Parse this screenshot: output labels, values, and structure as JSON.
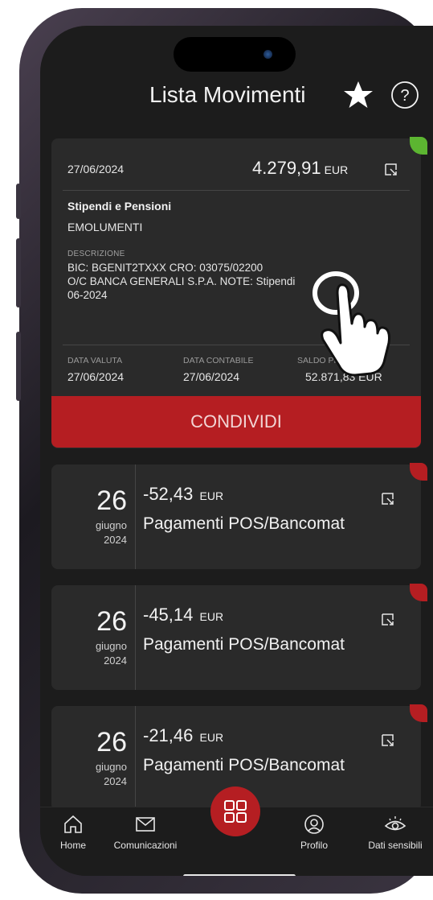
{
  "header": {
    "title": "Lista Movimenti"
  },
  "detail": {
    "date": "27/06/2024",
    "amount": "4.279,91",
    "currency": "EUR",
    "category": "Stipendi e Pensioni",
    "subcategory": "EMOLUMENTI",
    "description_label": "DESCRIZIONE",
    "description_line1": "BIC: BGENIT2TXXX CRO: 03075/02200",
    "description_line2": "O/C BANCA GENERALI S.P.A. NOTE: Stipendi",
    "description_line3": "06-2024",
    "valuta_label": "DATA VALUTA",
    "valuta_value": "27/06/2024",
    "contabile_label": "DATA CONTABILE",
    "contabile_value": "27/06/2024",
    "saldo_label": "SALDO PROGR",
    "saldo_value": "52.871,83 EUR",
    "status_color": "#5cb531"
  },
  "share_button": "CONDIVIDI",
  "movements": [
    {
      "day": "26",
      "month": "giugno",
      "year": "2024",
      "amount": "-52,43",
      "currency": "EUR",
      "category": "Pagamenti POS/Bancomat"
    },
    {
      "day": "26",
      "month": "giugno",
      "year": "2024",
      "amount": "-45,14",
      "currency": "EUR",
      "category": "Pagamenti POS/Bancomat"
    },
    {
      "day": "26",
      "month": "giugno",
      "year": "2024",
      "amount": "-21,46",
      "currency": "EUR",
      "category": "Pagamenti POS/Bancomat"
    }
  ],
  "negative_color": "#b51e22",
  "tabs": {
    "home": "Home",
    "comunicazioni": "Comunicazioni",
    "profilo": "Profilo",
    "dati_sensibili": "Dati sensibili"
  },
  "icons": [
    "star-icon",
    "help-icon",
    "external-link-icon",
    "home-icon",
    "mail-icon",
    "grid-icon",
    "profile-icon",
    "eye-icon",
    "hand-pointer-icon"
  ]
}
